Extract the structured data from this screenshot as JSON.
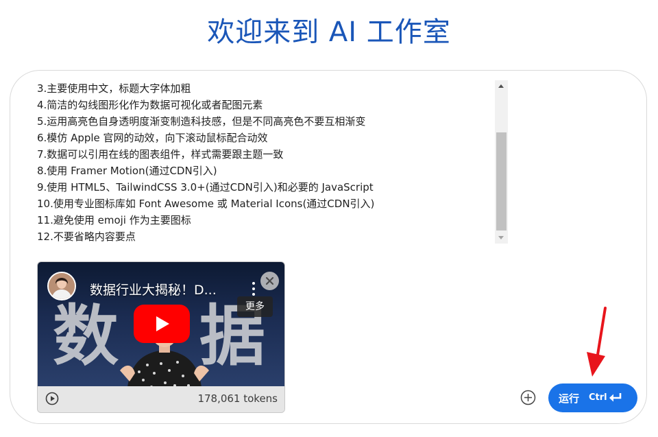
{
  "page": {
    "title": "欢迎来到 AI 工作室"
  },
  "prompt": {
    "lines": [
      "3.主要使用中文，标题大字体加粗",
      "4.简洁的勾线图形化作为数据可视化或者配图元素",
      "5.运用高亮色自身透明度渐变制造科技感，但是不同高亮色不要互相渐变",
      "6.模仿 Apple 官网的动效，向下滚动鼠标配合动效",
      "7.数据可以引用在线的图表组件，样式需要跟主题一致",
      "8.使用 Framer Motion(通过CDN引入)",
      "9.使用 HTML5、TailwindCSS 3.0+(通过CDN引入)和必要的 JavaScript",
      "10.使用专业图标库如 Font Awesome 或 Material Icons(通过CDN引入)",
      "11.避免使用 emoji 作为主要图标",
      "12.不要省略内容要点"
    ]
  },
  "video": {
    "title": "数据行业大揭秘！D...",
    "thumbnail_text_left": "数",
    "thumbnail_text_right": "据",
    "more_label": "更多",
    "token_count": "178,061 tokens",
    "icons": {
      "play": "youtube-play-icon",
      "close": "close-icon",
      "menu": "kebab-menu-icon",
      "footer_play": "play-circle-icon"
    }
  },
  "actions": {
    "add_icon": "add-circle-icon",
    "run_label": "运行",
    "run_shortcut": "Ctrl",
    "enter_icon": "enter-key-icon"
  },
  "colors": {
    "title": "#1a56b8",
    "run_button": "#1a73e8",
    "play_button": "#ff0000",
    "annotation_arrow": "#e8151c"
  }
}
